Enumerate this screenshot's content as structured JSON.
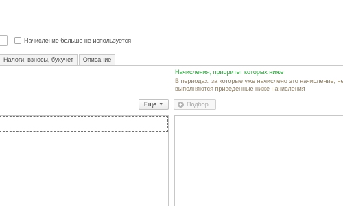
{
  "form": {
    "checkbox_label": "Начисление больше не используется"
  },
  "tabs": [
    {
      "label": "Налоги, взносы, бухучет"
    },
    {
      "label": "Описание"
    }
  ],
  "right_panel": {
    "title": "Начисления, приоритет которых ниже",
    "description": "В периодах, за которые уже начислено это начисление, не выполняются приведенные ниже начисления",
    "pick_button_label": "Подбор"
  },
  "left_panel": {
    "more_button_label": "Еще"
  }
}
